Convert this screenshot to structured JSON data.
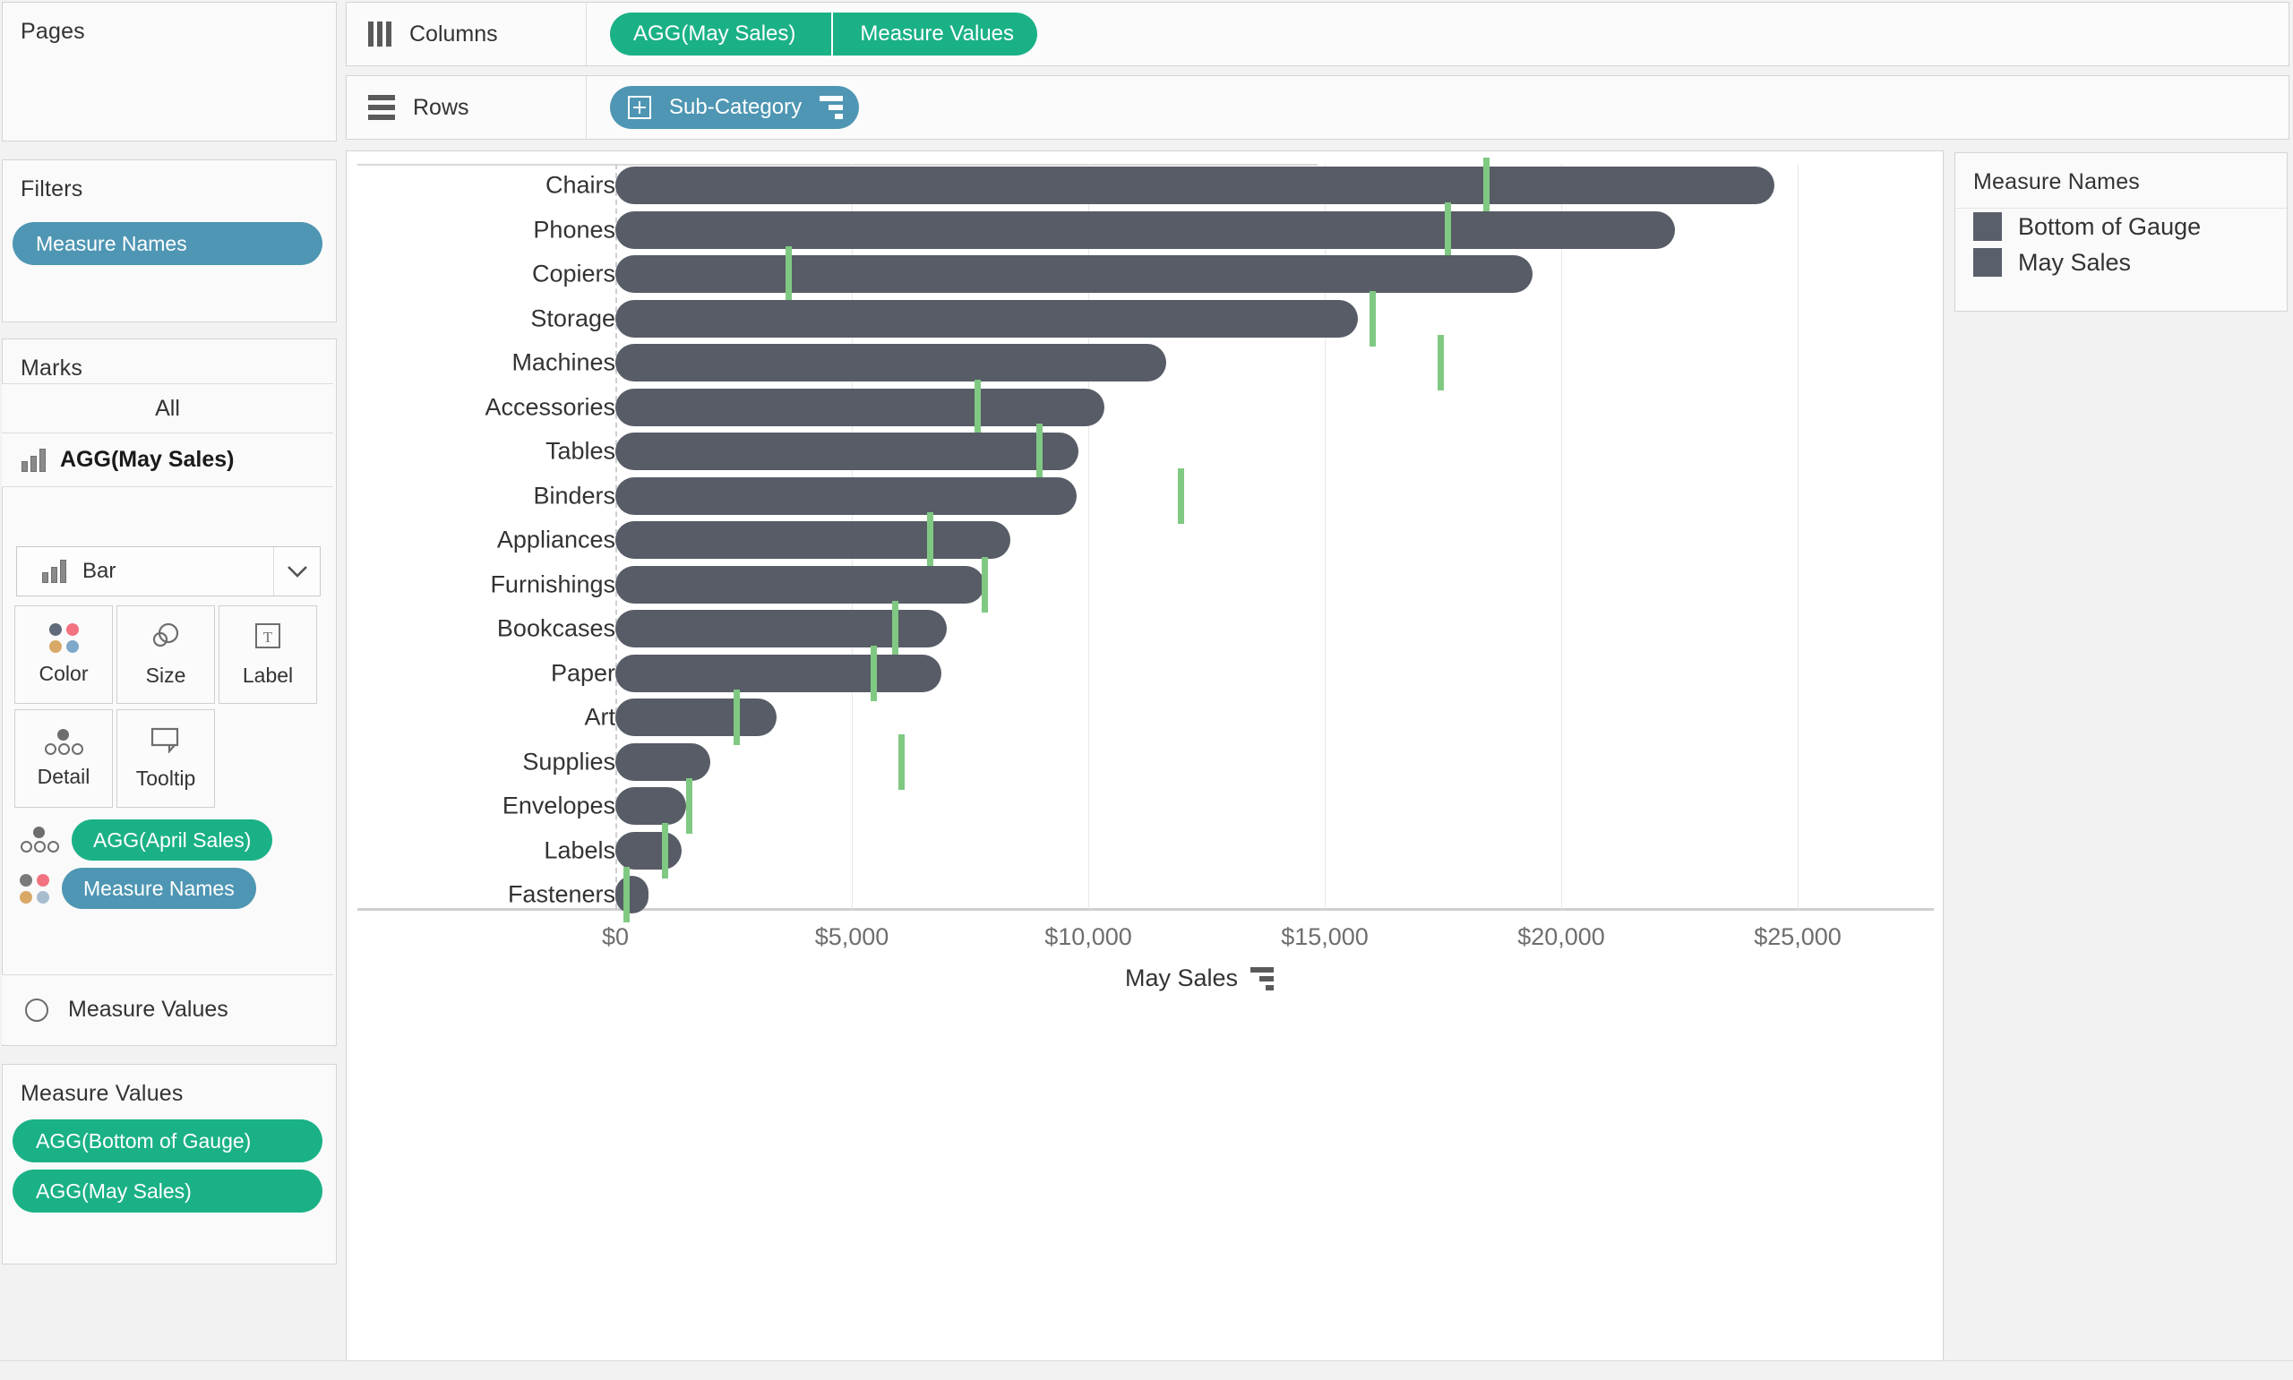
{
  "panels": {
    "pages": {
      "title": "Pages"
    },
    "filters": {
      "title": "Filters",
      "pill": "Measure Names"
    },
    "marks": {
      "title": "Marks",
      "all_label": "All",
      "card_name": "AGG(May Sales)",
      "mark_type": "Bar",
      "buttons": [
        {
          "id": "color",
          "label": "Color",
          "icon": "color-dots-icon"
        },
        {
          "id": "size",
          "label": "Size",
          "icon": "size-circles-icon"
        },
        {
          "id": "label",
          "label": "Label",
          "icon": "label-text-icon"
        },
        {
          "id": "detail",
          "label": "Detail",
          "icon": "detail-dots-icon"
        },
        {
          "id": "tooltip",
          "label": "Tooltip",
          "icon": "tooltip-bubble-icon"
        }
      ],
      "encodings": [
        {
          "icon": "detail-dots-icon",
          "pill": "AGG(April Sales)",
          "color": "green"
        },
        {
          "icon": "color-dots-icon",
          "pill": "Measure Names",
          "color": "blue"
        }
      ],
      "measure_values_shelf": "Measure Values"
    },
    "measure_values": {
      "title": "Measure Values",
      "pills": [
        "AGG(Bottom of Gauge)",
        "AGG(May Sales)"
      ]
    }
  },
  "shelves": {
    "columns": {
      "label": "Columns",
      "pills": [
        "AGG(May Sales)",
        "Measure Values"
      ]
    },
    "rows": {
      "label": "Rows",
      "pills": [
        "Sub-Category"
      ]
    }
  },
  "legend": {
    "title": "Measure Names",
    "items": [
      {
        "label": "Bottom of Gauge",
        "color": "#5a606b"
      },
      {
        "label": "May Sales",
        "color": "#5a606b"
      }
    ]
  },
  "colors": {
    "bar": "#575c66",
    "reference_line": "#80c983",
    "pill_green": "#1bb187",
    "pill_blue": "#4e96b3"
  },
  "chart_data": {
    "type": "bar",
    "title": "",
    "xlabel": "May Sales",
    "ylabel": "Sub-Category",
    "xlim": [
      0,
      26500
    ],
    "grid": true,
    "legend_position": "right",
    "tick_labels": [
      "$0",
      "$5,000",
      "$10,000",
      "$15,000",
      "$20,000",
      "$25,000"
    ],
    "tick_values": [
      0,
      5000,
      10000,
      15000,
      20000,
      25000
    ],
    "categories": [
      "Chairs",
      "Phones",
      "Copiers",
      "Storage",
      "Machines",
      "Accessories",
      "Tables",
      "Binders",
      "Appliances",
      "Furnishings",
      "Bookcases",
      "Paper",
      "Art",
      "Supplies",
      "Envelopes",
      "Labels",
      "Fasteners"
    ],
    "series": [
      {
        "name": "May Sales",
        "values": [
          24500,
          22400,
          19400,
          15700,
          11650,
          10350,
          9800,
          9750,
          8350,
          7800,
          7000,
          6900,
          3400,
          2000,
          1500,
          1400,
          700
        ]
      },
      {
        "name": "April Sales (reference)",
        "values": [
          18400,
          17600,
          3650,
          16000,
          17450,
          7650,
          8950,
          11950,
          6650,
          7800,
          5900,
          5450,
          2550,
          6050,
          1550,
          1050,
          230
        ]
      }
    ]
  }
}
